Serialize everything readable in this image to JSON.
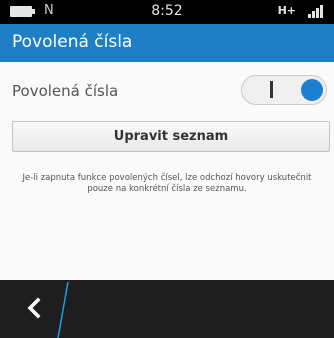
{
  "status_bar": {
    "notification": "N",
    "time": "8:52",
    "network": "H+",
    "icons": [
      "battery-icon",
      "signal-icon"
    ]
  },
  "header": {
    "title": "Povolená čísla"
  },
  "setting": {
    "label": "Povolená čísla",
    "toggle_state": "on",
    "toggle_on_glyph": "|"
  },
  "edit_button": {
    "label": "Upravit seznam"
  },
  "description": "Je-li zapnuta funkce povolených čísel, lze odchozí hovory uskutečnit pouze na konkrétní čísla ze seznamu.",
  "action_bar": {
    "back_icon": "back-icon"
  },
  "colors": {
    "accent": "#1f7fc6",
    "toggle_knob": "#1c7fd0",
    "action_bar": "#1e1e1e"
  }
}
